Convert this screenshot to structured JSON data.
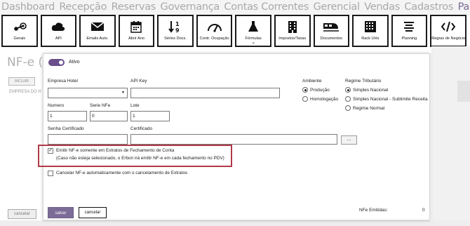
{
  "nav": {
    "items": [
      "Dashboard",
      "Recepção",
      "Reservas",
      "Governança",
      "Contas Correntes",
      "Gerencial",
      "Vendas",
      "Cadastros",
      "Parâmetros"
    ],
    "active_index": 8
  },
  "toolbar": {
    "buttons": [
      {
        "label": "Gerais",
        "icon": "steam-icon"
      },
      {
        "label": "API",
        "icon": "cloud-icon"
      },
      {
        "label": "Emails Auto.",
        "icon": "mail-icon"
      },
      {
        "label": "Abrir Ano",
        "icon": "calendar-icon"
      },
      {
        "label": "Séries Docs.",
        "icon": "sort-numeric-icon"
      },
      {
        "label": "Contr. Ocupação",
        "icon": "gauge-icon"
      },
      {
        "label": "Fórmulas",
        "icon": "flask-icon",
        "chevron": "⌄"
      },
      {
        "label": "Impostos/Taxas",
        "icon": "building-icon"
      },
      {
        "label": "Documentos",
        "icon": "train-icon"
      },
      {
        "label": "Rack UHs",
        "icon": "grid-icon"
      },
      {
        "label": "Planning",
        "icon": "align-center-icon"
      },
      {
        "label": "Regras de Negócio",
        "icon": "code-icon"
      }
    ]
  },
  "background": {
    "title": "NF-e (N",
    "include_label": "INCLUIR",
    "column_label": "EMPRESA DO H",
    "cancel_label": "cancelar"
  },
  "form": {
    "active_label": "Ativo",
    "empresa_hotel": {
      "label": "Empresa Hotel",
      "value": ""
    },
    "api_key": {
      "label": "API Key",
      "value": ""
    },
    "numero": {
      "label": "Numero",
      "value": "1"
    },
    "serie": {
      "label": "Serie NFe",
      "value": "0"
    },
    "lote": {
      "label": "Lote",
      "value": "1"
    },
    "senha": {
      "label": "Senha Certificado",
      "value": ""
    },
    "certificado": {
      "label": "Certificado",
      "value": ""
    },
    "browse_label": "...",
    "ambiente": {
      "label": "Ambiente",
      "options": [
        "Produção",
        "Homologação"
      ],
      "selected": "Produção"
    },
    "regime": {
      "label": "Regime Tributário",
      "options": [
        "Simples Nacional",
        "Simples Nacional - Sublimite Receita",
        "Regime Normal"
      ],
      "selected": "Simples Nacional"
    },
    "emitir": {
      "checked": true,
      "label": "Emitir NF-e somente em Extratos de Fechamento de Conta",
      "note": "(Caso não esteja selecionado, o Erbon irá emitir NF-e em cada fechamento no PDV)"
    },
    "cancelar_auto": {
      "checked": false,
      "label": "Cancelar NF-e automaticamente com o cancelamento de Extratos"
    },
    "save_label": "salvar",
    "cancel_label": "cancelar",
    "nfe_emitidas_label": "NFe Emitidas:",
    "nfe_emitidas_value": "0"
  }
}
